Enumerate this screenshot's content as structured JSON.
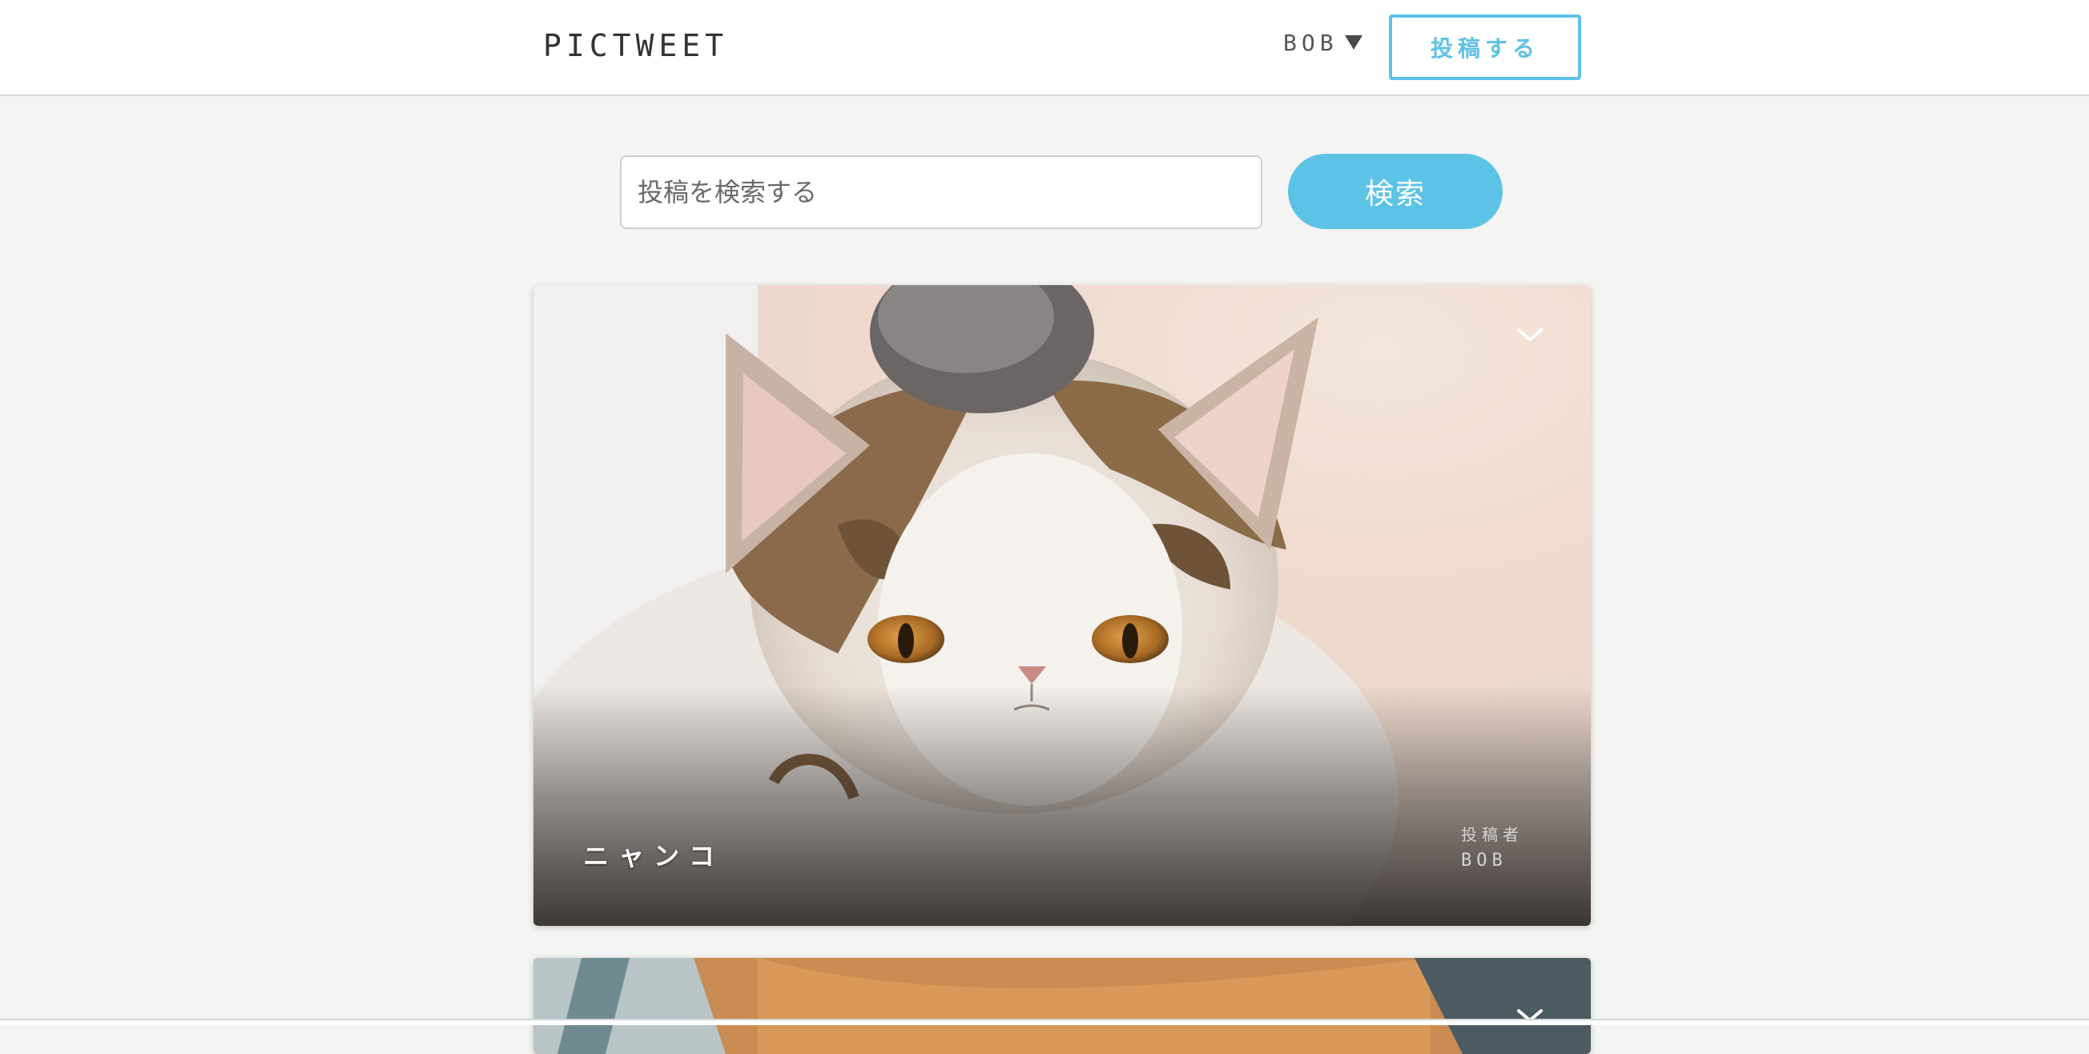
{
  "header": {
    "logo": "PICTWEET",
    "user_name": "BOB",
    "post_button": "投稿する"
  },
  "search": {
    "placeholder": "投稿を検索する",
    "value": "",
    "button": "検索"
  },
  "posts": [
    {
      "title": "ニャンコ",
      "author_label": "投稿者",
      "author": "BOB",
      "image": "white-and-tabby-exotic-shorthair-cat"
    },
    {
      "title": "",
      "author_label": "",
      "author": "",
      "image": "orange-cat-partial"
    }
  ],
  "icons": {
    "user_menu": "triangle-down-icon",
    "card_menu": "chevron-down-icon"
  },
  "colors": {
    "accent": "#5cc3e6",
    "background": "#f4f4f2",
    "header": "#ffffff"
  }
}
